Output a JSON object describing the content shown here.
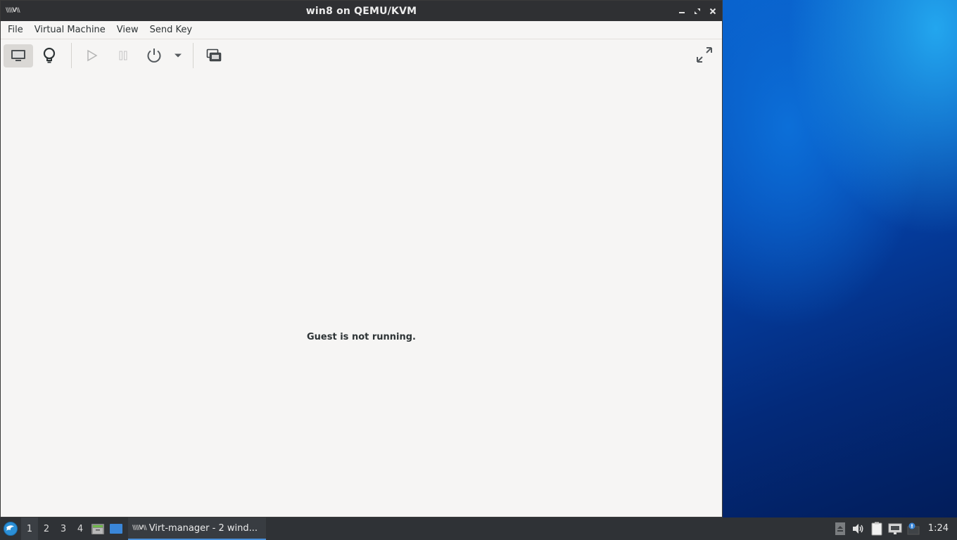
{
  "window": {
    "title": "win8 on QEMU/KVM",
    "app_icon_text": "\\\\\\\\V\\\\"
  },
  "menubar": {
    "items": [
      {
        "label": "File"
      },
      {
        "label": "Virtual Machine"
      },
      {
        "label": "View"
      },
      {
        "label": "Send Key"
      }
    ]
  },
  "toolbar": {
    "buttons": [
      {
        "icon": "monitor-icon",
        "active": true
      },
      {
        "icon": "lightbulb-icon"
      },
      {
        "icon": "play-icon",
        "disabled": true
      },
      {
        "icon": "pause-icon",
        "disabled": true
      },
      {
        "icon": "power-icon"
      },
      {
        "icon": "chevron-down-icon"
      },
      {
        "icon": "snapshots-icon"
      },
      {
        "icon": "fullscreen-icon"
      }
    ]
  },
  "viewer": {
    "message": "Guest is not running."
  },
  "taskbar": {
    "workspaces": [
      "1",
      "2",
      "3",
      "4"
    ],
    "current_workspace": "1",
    "task_label": "Virt-manager - 2 wind...",
    "task_icon_text": "\\\\\\\\V\\\\",
    "clock": "1:24"
  },
  "colors": {
    "titlebar": "#2f3033",
    "window_bg": "#f6f5f4",
    "taskbar": "#2f3236",
    "accent": "#4a90d9"
  }
}
